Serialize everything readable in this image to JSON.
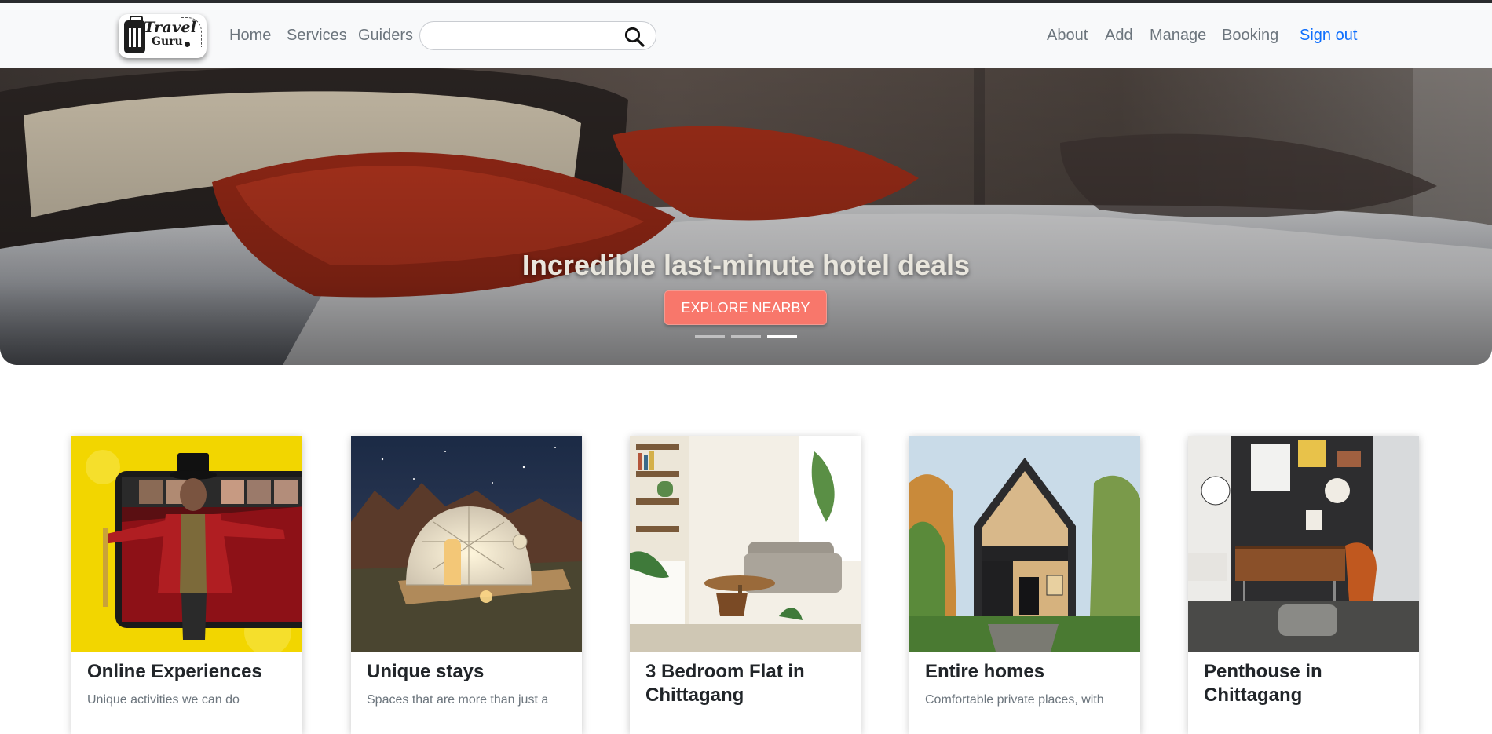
{
  "brand": {
    "line1": "Travel",
    "line2": "Guru"
  },
  "nav": {
    "left": [
      "Home",
      "Services",
      "Guiders"
    ],
    "right": [
      "About",
      "Add",
      "Manage",
      "Booking"
    ],
    "sign_out": "Sign out",
    "accent_color": "#0d6efd"
  },
  "search": {
    "value": "",
    "placeholder": "",
    "icon": "search-icon"
  },
  "hero": {
    "title": "Incredible last-minute hotel deals",
    "button": "EXPLORE NEARBY",
    "button_color": "#f8776b",
    "slides": 3,
    "active_slide": 3
  },
  "cards": [
    {
      "title": "Online Experiences",
      "text": "Unique activities we can do"
    },
    {
      "title": "Unique stays",
      "text": "Spaces that are more than just a"
    },
    {
      "title": "3 Bedroom Flat in Chittagang",
      "text": ""
    },
    {
      "title": "Entire homes",
      "text": "Comfortable private places, with"
    },
    {
      "title": "Penthouse in Chittagang",
      "text": ""
    }
  ]
}
